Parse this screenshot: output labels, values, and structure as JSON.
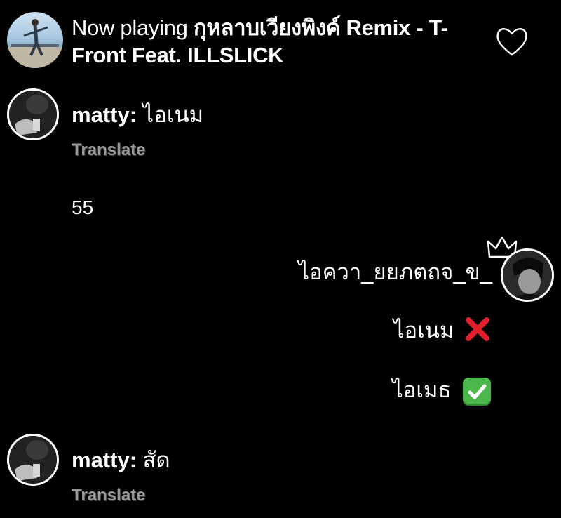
{
  "now_playing": {
    "lead": "Now playing",
    "song": "กุหลาบเวียงพิงค์ Remix - T- Front Feat. ILLSLICK"
  },
  "messages": [
    {
      "user": "matty:",
      "text": "ไอเนม",
      "translate_label": "Translate"
    },
    {
      "text": "55"
    },
    {
      "text": "ไอควา_ยยภตถจ_ข_"
    },
    {
      "text": "ไอเนม",
      "emoji": "cross-mark-icon"
    },
    {
      "text": "ไอเมธ",
      "emoji": "check-mark-button-icon"
    },
    {
      "user": "matty:",
      "text": "สัด",
      "translate_label": "Translate"
    }
  ]
}
